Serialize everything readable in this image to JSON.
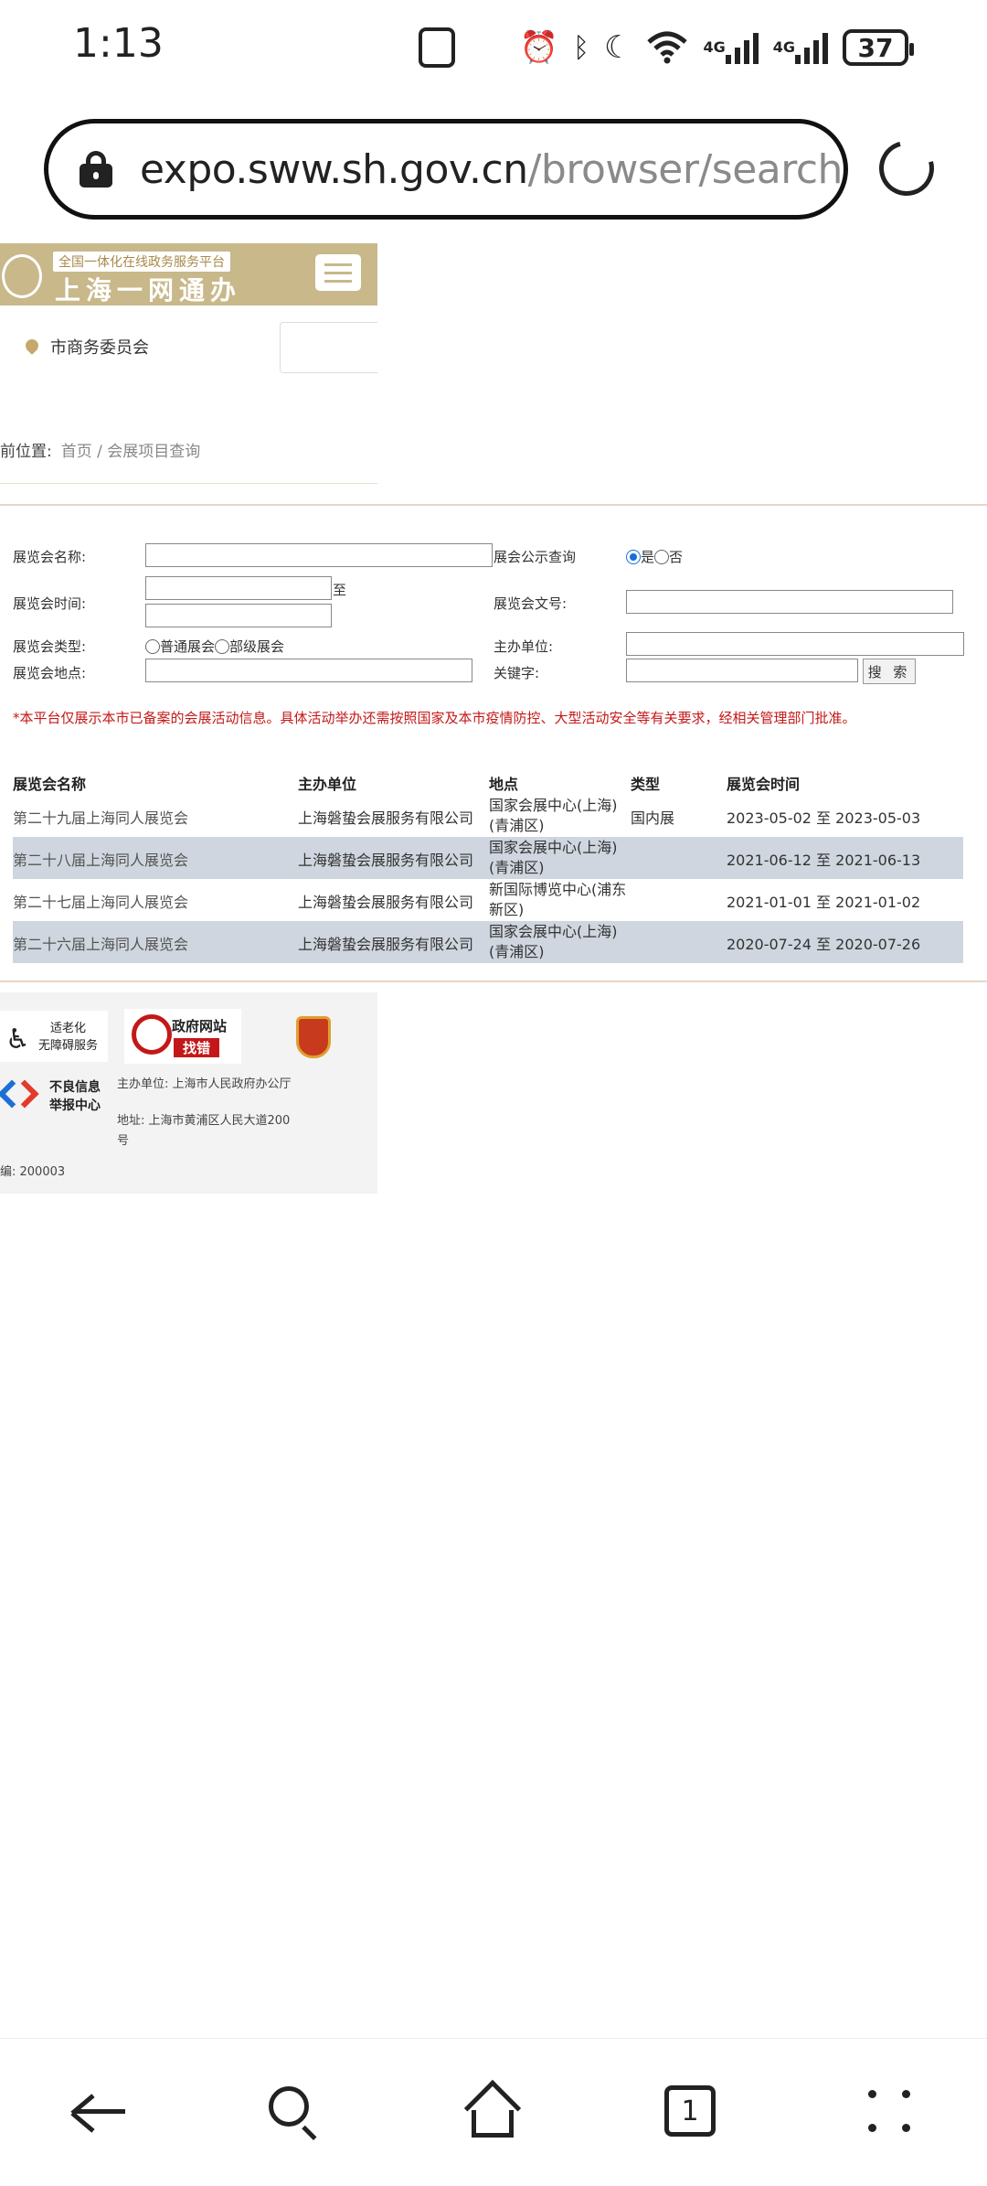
{
  "status_bar": {
    "time": "1:13",
    "net1": "4G",
    "net2": "4G",
    "battery": "37"
  },
  "browser": {
    "url_host": "expo.sww.sh.gov.cn",
    "url_path": "/browser/search-"
  },
  "header": {
    "banner_subtitle": "全国一体化在线政务服务平台",
    "banner_title": "上海一网通办",
    "location": "市商务委员会"
  },
  "breadcrumb": {
    "label": "前位置:",
    "path": "首页 / 会展项目查询"
  },
  "form": {
    "name_label": "展览会名称:",
    "publicity_label": "展会公示查询",
    "publicity_yes": "是",
    "publicity_no": "否",
    "time_label": "展览会时间:",
    "time_to": "至",
    "doc_no_label": "展览会文号:",
    "type_label": "展览会类型:",
    "type_opt1": "普通展会",
    "type_opt2": "部级展会",
    "host_label": "主办单位:",
    "place_label": "展览会地点:",
    "keyword_label": "关键字:",
    "search_button": "搜 索",
    "notice": "*本平台仅展示本市已备案的会展活动信息。具体活动举办还需按照国家及本市疫情防控、大型活动安全等有关要求，经相关管理部门批准。"
  },
  "table": {
    "headers": [
      "展览会名称",
      "主办单位",
      "地点",
      "类型",
      "展览会时间"
    ],
    "rows": [
      {
        "name": "第二十九届上海同人展览会",
        "host": "上海磐蛰会展服务有限公司",
        "place1": "国家会展中心(上海)",
        "place2": "(青浦区)",
        "type": "国内展",
        "time": "2023-05-02 至 2023-05-03"
      },
      {
        "name": "第二十八届上海同人展览会",
        "host": "上海磐蛰会展服务有限公司",
        "place1": "国家会展中心(上海)",
        "place2": "(青浦区)",
        "type": "",
        "time": "2021-06-12 至 2021-06-13"
      },
      {
        "name": "第二十七届上海同人展览会",
        "host": "上海磐蛰会展服务有限公司",
        "place1": "新国际博览中心(浦东",
        "place2": "新区)",
        "type": "",
        "time": "2021-01-01 至 2021-01-02"
      },
      {
        "name": "第二十六届上海同人展览会",
        "host": "上海磐蛰会展服务有限公司",
        "place1": "国家会展中心(上海)",
        "place2": "(青浦区)",
        "type": "",
        "time": "2020-07-24 至 2020-07-26"
      }
    ]
  },
  "footer": {
    "access_line1": "适老化",
    "access_line2": "无障碍服务",
    "gov_site_line1": "政府网站",
    "gov_site_line2": "找错",
    "report_line1": "不良信息",
    "report_line2": "举报中心",
    "host": "主办单位:  上海市人民政府办公厅",
    "address_line1": "地址:  上海市黄浦区人民大道200",
    "address_line2": "号",
    "postcode": "编:  200003"
  },
  "nav": {
    "tab_count": "1"
  }
}
